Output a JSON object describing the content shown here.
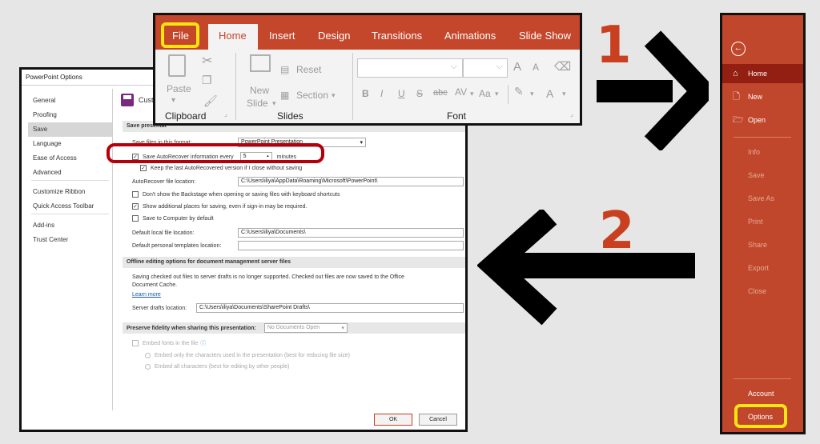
{
  "ribbon": {
    "tabs": {
      "file": "File",
      "home": "Home",
      "insert": "Insert",
      "design": "Design",
      "transitions": "Transitions",
      "animations": "Animations",
      "slideshow": "Slide Show"
    },
    "clipboard": {
      "paste": "Paste",
      "group": "Clipboard"
    },
    "slides": {
      "new_slide_1": "New",
      "new_slide_2": "Slide",
      "reset": "Reset",
      "section": "Section",
      "group": "Slides"
    },
    "font": {
      "grow": "A",
      "shrink": "A",
      "bold": "B",
      "italic": "I",
      "underline": "U",
      "strike": "S",
      "strike_abc": "abc",
      "spacing": "AV",
      "case": "Aa",
      "color": "A",
      "group": "Font"
    }
  },
  "steps": {
    "one": "1",
    "two": "2"
  },
  "backstage": {
    "home": "Home",
    "new": "New",
    "open": "Open",
    "info": "Info",
    "save": "Save",
    "save_as": "Save As",
    "print": "Print",
    "share": "Share",
    "export": "Export",
    "close": "Close",
    "account": "Account",
    "options": "Options"
  },
  "dialog": {
    "title": "PowerPoint Options",
    "nav": [
      "General",
      "Proofing",
      "Save",
      "Language",
      "Ease of Access",
      "Advanced",
      "Customize Ribbon",
      "Quick Access Toolbar",
      "Add-ins",
      "Trust Center"
    ],
    "header": "Custo",
    "section1_title": "Save presentat",
    "save_format_label": "Save files in this format:",
    "save_format_value": "PowerPoint Presentation",
    "autorecover_label": "Save AutoRecover information every",
    "autorecover_value": "5",
    "autorecover_unit": "minutes",
    "keep_last_label": "Keep the last AutoRecovered version if I close without saving",
    "autorecover_location_label": "AutoRecover file location:",
    "autorecover_location_value": "C:\\Users\\iliya\\AppData\\Roaming\\Microsoft\\PowerPoint\\",
    "backstage_label": "Don't show the Backstage when opening or saving files with keyboard shortcuts",
    "additional_places_label": "Show additional places for saving, even if sign-in may be required.",
    "save_computer_label": "Save to Computer by default",
    "default_local_label": "Default local file location:",
    "default_local_value": "C:\\Users\\iliya\\Documents\\",
    "default_templates_label": "Default personal templates location:",
    "default_templates_value": "",
    "section2_title": "Offline editing options for document management server files",
    "offline_text_1": "Saving checked out files to server drafts is no longer supported. Checked out files are now saved to the Office",
    "offline_text_2": "Document Cache.",
    "learn_more": "Learn more",
    "server_drafts_label": "Server drafts location:",
    "server_drafts_value": "C:\\Users\\iliya\\Documents\\SharePoint Drafts\\",
    "section3_title": "Preserve fidelity when sharing this presentation:",
    "section3_select": "No Documents Open",
    "embed_fonts_label": "Embed fonts in the file",
    "embed_used_label": "Embed only the characters used in the presentation (best for reducing file size)",
    "embed_all_label": "Embed all characters (best for editing by other people)",
    "ok": "OK",
    "cancel": "Cancel"
  }
}
